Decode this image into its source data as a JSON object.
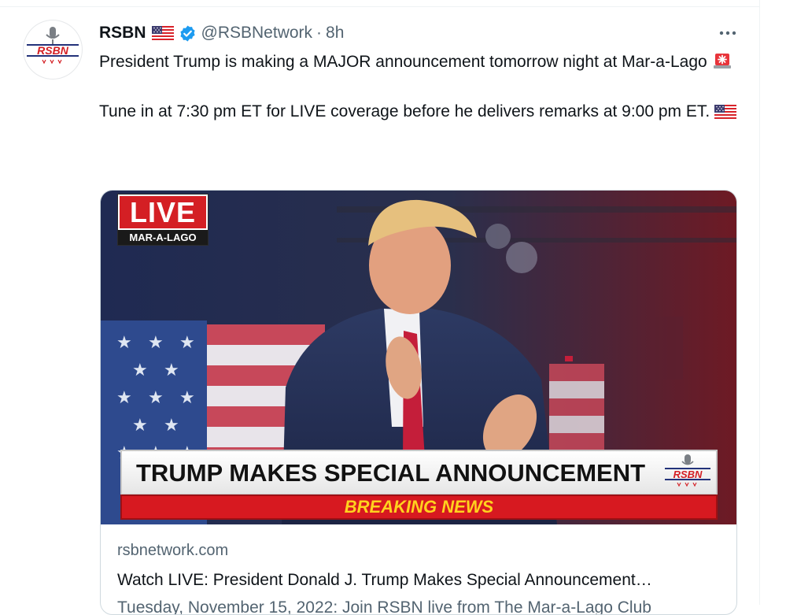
{
  "tweet": {
    "author_name": "RSBN",
    "handle": "@RSBNetwork",
    "separator": "·",
    "time": "8h",
    "avatar_text": "RSBN",
    "paragraph_1": "President Trump is making a MAJOR announcement tomorrow night at Mar-a-Lago",
    "paragraph_2": "Tune in at 7:30 pm ET for LIVE coverage before he delivers remarks at 9:00 pm ET.",
    "icons": {
      "flag": "us-flag-icon",
      "verified": "verified-badge-icon",
      "more": "more-icon",
      "siren": "police-light-icon"
    },
    "colors": {
      "verified": "#1d9bf0",
      "secondary_text": "#536471",
      "brand_red": "#d41f24"
    }
  },
  "card": {
    "live_label": "LIVE",
    "live_sub": "MAR-A-LAGO",
    "banner_title": "TRUMP MAKES SPECIAL ANNOUNCEMENT",
    "banner_logo_text": "RSBN",
    "breaking_label": "BREAKING NEWS",
    "domain": "rsbnetwork.com",
    "title": "Watch LIVE: President Donald J. Trump Makes Special Announcement…",
    "description": "Tuesday, November 15, 2022: Join RSBN live from The Mar-a-Lago Club"
  }
}
